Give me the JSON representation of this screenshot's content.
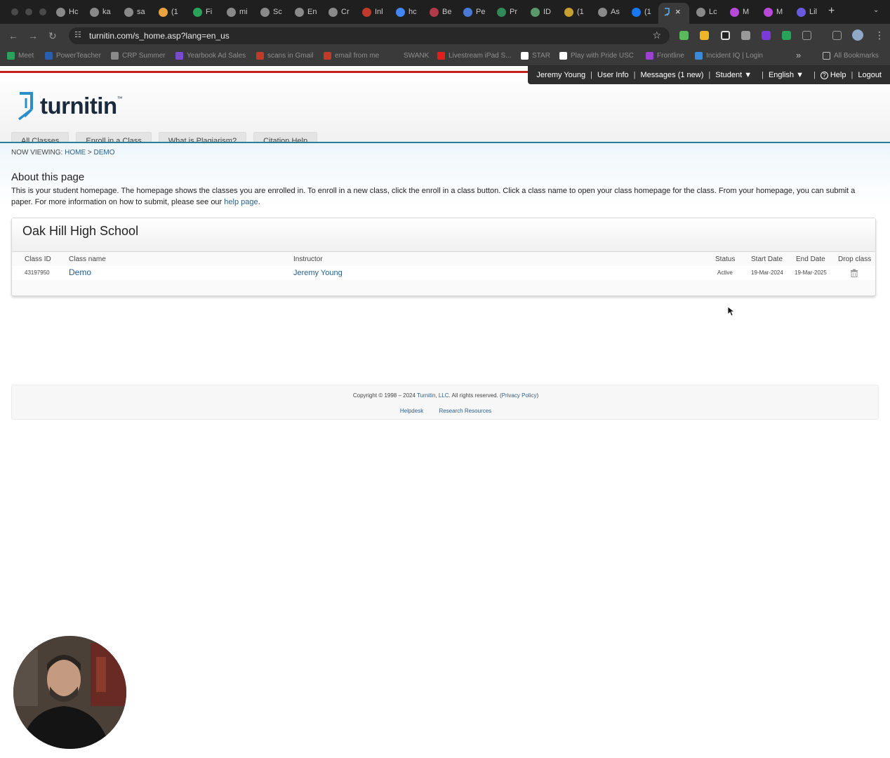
{
  "browser": {
    "tabs": [
      {
        "label": "Hc",
        "color": "#8a8a8a"
      },
      {
        "label": "ka",
        "color": "#8a8a8a"
      },
      {
        "label": "sa",
        "color": "#8a8a8a"
      },
      {
        "label": "(1",
        "color": "#e8a33c"
      },
      {
        "label": "Fi",
        "color": "#2aa35a"
      },
      {
        "label": "mi",
        "color": "#8a8a8a"
      },
      {
        "label": "Sc",
        "color": "#8a8a8a"
      },
      {
        "label": "En",
        "color": "#8a8a8a"
      },
      {
        "label": "Cr",
        "color": "#8a8a8a"
      },
      {
        "label": "Inl",
        "color": "#c0392b"
      },
      {
        "label": "hc",
        "color": "#4285f4"
      },
      {
        "label": "Be",
        "color": "#b03a48"
      },
      {
        "label": "Pe",
        "color": "#4a7ad8"
      },
      {
        "label": "Pr",
        "color": "#2e8b57"
      },
      {
        "label": "ID",
        "color": "#5a9a6a"
      },
      {
        "label": "(1",
        "color": "#c8a030"
      },
      {
        "label": "As",
        "color": "#8a8a8a"
      },
      {
        "label": "(1",
        "color": "#1877f2"
      }
    ],
    "tabs_after": [
      {
        "label": "Lc",
        "color": "#8a8a8a"
      },
      {
        "label": "M",
        "color": "#b84ad8"
      },
      {
        "label": "M",
        "color": "#b84ad8"
      },
      {
        "label": "Lil",
        "color": "#6a5ae0"
      }
    ],
    "active_tab_close": "×",
    "new_tab": "+",
    "url": "turnitin.com/s_home.asp?lang=en_us",
    "bookmarks": [
      {
        "label": "Meet",
        "color": "#2aa35a"
      },
      {
        "label": "PowerTeacher",
        "color": "#2a5fb0"
      },
      {
        "label": "CRP Summer",
        "color": "#8a8a8a"
      },
      {
        "label": "Yearbook Ad Sales",
        "color": "#7a4ad0"
      },
      {
        "label": "scans in Gmail",
        "color": "#c0392b"
      },
      {
        "label": "email from me",
        "color": "#c0392b"
      },
      {
        "label": "SWANK",
        "color": ""
      },
      {
        "label": "Livestream iPad S...",
        "color": "#e02020"
      },
      {
        "label": "STAR",
        "color": "#ffffff"
      },
      {
        "label": "Play with Pride USC",
        "color": "#ffffff"
      },
      {
        "label": "Frontline",
        "color": "#a040d0"
      },
      {
        "label": "Incident IQ | Login",
        "color": "#3a8ad8"
      }
    ],
    "bookmarks_overflow": "»",
    "all_bookmarks": "All Bookmarks"
  },
  "topnav": {
    "user": "Jeremy Young",
    "user_info": "User Info",
    "messages": "Messages (1 new)",
    "role": "Student ▼",
    "language": "English ▼",
    "help": "Help",
    "logout": "Logout"
  },
  "logo": {
    "text": "turnitin",
    "tm": "™",
    "color": "#2a8fc9"
  },
  "nav_tabs": [
    "All Classes",
    "Enroll in a Class",
    "What is Plagiarism?",
    "Citation Help"
  ],
  "breadcrumb": {
    "prefix": "NOW VIEWING:",
    "home": "HOME",
    "separator": ">",
    "current": "DEMO"
  },
  "about": {
    "title": "About this page",
    "text": "This is your student homepage. The homepage shows the classes you are enrolled in. To enroll in a new class, click the enroll in a class button. Click a class name to open your class homepage for the class. From your homepage, you can submit a paper. For more information on how to submit, please see our",
    "link": "help page",
    "end": "."
  },
  "school": {
    "name": "Oak Hill High School",
    "columns": [
      "Class ID",
      "Class name",
      "Instructor",
      "Status",
      "Start Date",
      "End Date",
      "Drop class"
    ],
    "rows": [
      {
        "class_id": "43197950",
        "class_name": "Demo",
        "instructor": "Jeremy Young",
        "status": "Active",
        "start": "19-Mar-2024",
        "end": "19-Mar-2025"
      }
    ]
  },
  "footer": {
    "copyright_prefix": "Copyright © 1998 – 2024",
    "company": "Turnitin, LLC",
    "rights": ". All rights reserved. (",
    "privacy": "Privacy Policy",
    "close": ")",
    "links": [
      "Helpdesk",
      "Research Resources"
    ]
  }
}
